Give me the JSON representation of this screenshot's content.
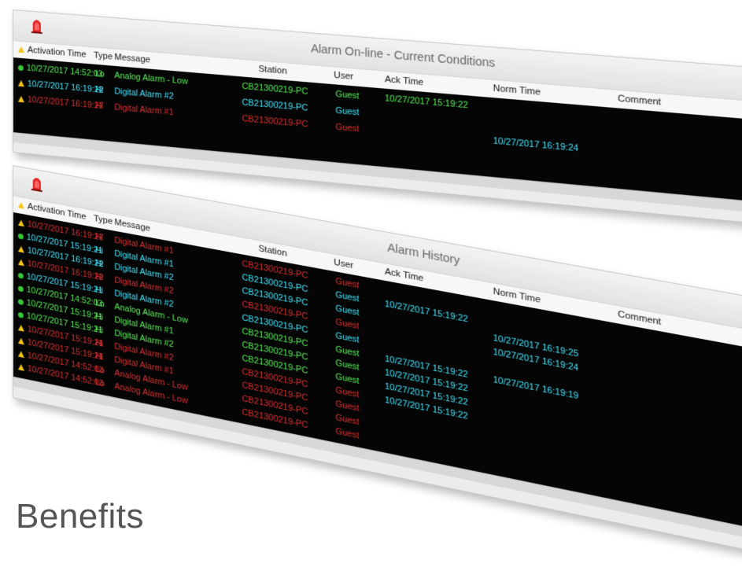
{
  "panels": [
    {
      "title": "Alarm On-line - Current Conditions",
      "columns": {
        "activation": "Activation Time",
        "type": "Type",
        "message": "Message",
        "station": "Station",
        "user": "User",
        "ack": "Ack Time",
        "norm": "Norm Time",
        "comment": "Comment"
      },
      "rows": [
        {
          "icon": "status-dot",
          "color": "green",
          "activation": "10/27/2017 14:52:03",
          "type": "Lo",
          "message": "Analog Alarm - Low",
          "station": "CB21300219-PC",
          "user": "Guest",
          "ack": "10/27/2017 15:19:22",
          "norm": "",
          "comment": ""
        },
        {
          "icon": "warning-icon",
          "color": "cyan",
          "activation": "10/27/2017 16:19:22",
          "type": "Hi",
          "message": "Digital Alarm #2",
          "station": "CB21300219-PC",
          "user": "Guest",
          "ack": "",
          "norm": "",
          "comment": ""
        },
        {
          "icon": "warning-icon",
          "color": "red",
          "activation": "10/27/2017 16:19:27",
          "type": "Hi",
          "message": "Digital Alarm #1",
          "station": "CB21300219-PC",
          "user": "Guest",
          "ack": "",
          "norm": "10/27/2017 16:19:24",
          "comment": ""
        }
      ]
    },
    {
      "title": "Alarm History",
      "columns": {
        "activation": "Activation Time",
        "type": "Type",
        "message": "Message",
        "station": "Station",
        "user": "User",
        "ack": "Ack Time",
        "norm": "Norm Time",
        "comment": "Comment"
      },
      "rows": [
        {
          "icon": "warning-icon",
          "color": "red",
          "activation": "10/27/2017 16:19:27",
          "type": "Hi",
          "message": "Digital Alarm #1",
          "station": "CB21300219-PC",
          "user": "Guest",
          "ack": "",
          "norm": "",
          "comment": ""
        },
        {
          "icon": "status-dot",
          "color": "cyan",
          "activation": "10/27/2017 15:19:21",
          "type": "Hi",
          "message": "Digital Alarm #1",
          "station": "CB21300219-PC",
          "user": "Guest",
          "ack": "10/27/2017 15:19:22",
          "norm": "",
          "comment": ""
        },
        {
          "icon": "warning-icon",
          "color": "cyan",
          "activation": "10/27/2017 16:19:22",
          "type": "Hi",
          "message": "Digital Alarm #2",
          "station": "CB21300219-PC",
          "user": "Guest",
          "ack": "",
          "norm": "10/27/2017 16:19:25",
          "comment": ""
        },
        {
          "icon": "warning-icon",
          "color": "red",
          "activation": "10/27/2017 16:19:22",
          "type": "Hi",
          "message": "Digital Alarm #2",
          "station": "CB21300219-PC",
          "user": "Guest",
          "ack": "",
          "norm": "10/27/2017 16:19:24",
          "comment": ""
        },
        {
          "icon": "status-dot",
          "color": "cyan",
          "activation": "10/27/2017 15:19:21",
          "type": "Hi",
          "message": "Digital Alarm #2",
          "station": "CB21300219-PC",
          "user": "Guest",
          "ack": "",
          "norm": "",
          "comment": ""
        },
        {
          "icon": "status-dot",
          "color": "green",
          "activation": "10/27/2017 14:52:03",
          "type": "Lo",
          "message": "Analog Alarm - Low",
          "station": "CB21300219-PC",
          "user": "Guest",
          "ack": "10/27/2017 15:19:22",
          "norm": "10/27/2017 16:19:19",
          "comment": ""
        },
        {
          "icon": "status-dot",
          "color": "green",
          "activation": "10/27/2017 15:19:21",
          "type": "Hi",
          "message": "Digital Alarm #1",
          "station": "CB21300219-PC",
          "user": "Guest",
          "ack": "10/27/2017 15:19:22",
          "norm": "",
          "comment": ""
        },
        {
          "icon": "status-dot",
          "color": "green",
          "activation": "10/27/2017 15:19:21",
          "type": "Hi",
          "message": "Digital Alarm #2",
          "station": "CB21300219-PC",
          "user": "Guest",
          "ack": "10/27/2017 15:19:22",
          "norm": "",
          "comment": ""
        },
        {
          "icon": "warning-icon",
          "color": "red",
          "activation": "10/27/2017 15:19:21",
          "type": "Hi",
          "message": "Digital Alarm #2",
          "station": "CB21300219-PC",
          "user": "Guest",
          "ack": "10/27/2017 15:19:22",
          "norm": "",
          "comment": ""
        },
        {
          "icon": "warning-icon",
          "color": "red",
          "activation": "10/27/2017 15:19:21",
          "type": "Hi",
          "message": "Digital Alarm #1",
          "station": "CB21300219-PC",
          "user": "Guest",
          "ack": "",
          "norm": "",
          "comment": ""
        },
        {
          "icon": "warning-icon",
          "color": "red",
          "activation": "10/27/2017 14:52:03",
          "type": "Lo",
          "message": "Analog Alarm - Low",
          "station": "CB21300219-PC",
          "user": "Guest",
          "ack": "",
          "norm": "",
          "comment": ""
        },
        {
          "icon": "warning-icon",
          "color": "red",
          "activation": "10/27/2017 14:52:03",
          "type": "Lo",
          "message": "Analog Alarm - Low",
          "station": "CB21300219-PC",
          "user": "Guest",
          "ack": "",
          "norm": "",
          "comment": ""
        }
      ]
    }
  ],
  "caption": "Benefits",
  "colors": {
    "green": "#59f059",
    "red": "#e03030",
    "cyan": "#43e7ff",
    "background": "#050505",
    "header": "#ececec",
    "warning": "#f5c518"
  }
}
